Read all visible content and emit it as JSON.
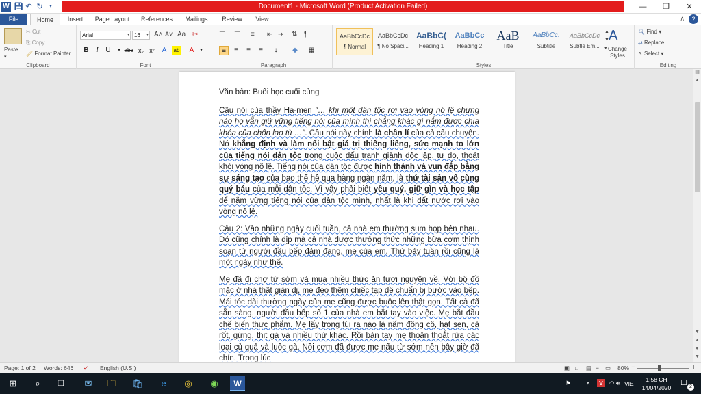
{
  "titlebar": {
    "title": "Document1 - Microsoft Word (Product Activation Failed)",
    "minimize": "—",
    "restore": "❐",
    "close": "✕"
  },
  "tabs": [
    "File",
    "Home",
    "Insert",
    "Page Layout",
    "References",
    "Mailings",
    "Review",
    "View"
  ],
  "ribbon": {
    "clipboard": {
      "label": "Clipboard",
      "paste": "Paste",
      "cut": "Cut",
      "copy": "Copy",
      "format_painter": "Format Painter"
    },
    "font": {
      "label": "Font",
      "name": "Arial",
      "size": "16"
    },
    "paragraph": {
      "label": "Paragraph"
    },
    "styles": {
      "label": "Styles",
      "items": [
        {
          "sample": "AaBbCcDc",
          "name": "¶ Normal"
        },
        {
          "sample": "AaBbCcDc",
          "name": "¶ No Spaci..."
        },
        {
          "sample": "AaBbC(",
          "name": "Heading 1"
        },
        {
          "sample": "AaBbCc",
          "name": "Heading 2"
        },
        {
          "sample": "AaB",
          "name": "Title"
        },
        {
          "sample": "AaBbCc.",
          "name": "Subtitle"
        },
        {
          "sample": "AaBbCcDc",
          "name": "Subtle Em..."
        }
      ],
      "change_styles": "Change Styles"
    },
    "editing": {
      "label": "Editing",
      "find": "Find",
      "replace": "Replace",
      "select": "Select"
    }
  },
  "document": {
    "heading": "Văn bản: Buổi học cuối cùng",
    "p1": [
      {
        "t": "Câu nói của thầy Ha-men ",
        "s": "sq"
      },
      {
        "t": "\"… khi một dân tộc rơi vào vòng nô lệ chừng nào họ vẫn giữ vững tiếng nói của mình thì chẳng khác gì nắm được chìa khóa của chốn lao tù …\"",
        "s": "sq i"
      },
      {
        "t": ". Câu nói này chính ",
        "s": "sq"
      },
      {
        "t": "là chân lí",
        "s": "sq b"
      },
      {
        "t": " của cả câu chuyện. Nó ",
        "s": "sq"
      },
      {
        "t": "khẳng định và làm nổi bật giá trị thiêng liêng, sức mạnh to lớn của tiếng nói dân tộc",
        "s": "sq b"
      },
      {
        "t": " trong cuộc đấu tranh giành độc lập, tự do, thoát khỏi vòng nô lệ. Tiếng nói của dân tộc được ",
        "s": "sq"
      },
      {
        "t": "hình thành và vun đắp bằng sự sáng tạo",
        "s": "sq b"
      },
      {
        "t": " của bao thế hệ qua hàng ngàn năm, là ",
        "s": "sq"
      },
      {
        "t": "thứ tài sản vô cùng quý báu",
        "s": "sq b"
      },
      {
        "t": " của mỗi dân tộc. Vì vậy phải biết ",
        "s": "sq"
      },
      {
        "t": "yêu quý, giữ gìn và học tập",
        "s": "sq b"
      },
      {
        "t": " để nắm vững tiếng nói của dân tộc mình, nhất là khi đất nước rơi vào vòng nô lệ.",
        "s": "sq"
      }
    ],
    "p2_label": "Câu 2: ",
    "p2": "Vào những ngày cuối tuần, cả nhà em thường sum họp bên nhau. Đó cũng chính là dịp mà cả nhà được thưởng thức những bữa cơm thịnh soạn từ người đầu bếp đảm đang, mẹ của em. Thứ bảy tuần rồi cũng là một ngày như thế.",
    "p3": "Mẹ đã đi chợ từ sớm và mua nhiều thức ăn tươi nguyên về. Với bộ đồ mặc ở nhà thật giản dị, mẹ đeo thêm chiếc tạp dề chuẩn bị bước vào bếp. Mái tóc dài thường ngày của mẹ cũng được buộc lên thật gọn. Tất cả đã sẵn sàng, người đầu bếp số 1 của nhà em bắt tay vào việc. Mẹ bắt đầu chế biến thực phẩm. Mẹ lấy trong túi ra nào là nấm đông cô, hạt sen, cà rốt, gừng, thịt gà và nhiều thứ khác. Rồi bàn tay mẹ thoăn thoắt rửa các loại củ quả và luộc gà. Nồi cơm đã được mẹ nấu từ sớm nên bây giờ đã chín. Trong lúc"
  },
  "statusbar": {
    "page": "Page: 1 of 2",
    "words": "Words: 646",
    "language": "English (U.S.)",
    "zoom": "80%",
    "zoom_minus": "−",
    "zoom_plus": "+"
  },
  "taskbar": {
    "lang": "VIE",
    "time": "1:58 CH",
    "date": "14/04/2020",
    "notifications": "2"
  },
  "colors": {
    "title_red": "#e31c1c",
    "word_blue": "#2b579a",
    "taskbar": "#111a22"
  }
}
